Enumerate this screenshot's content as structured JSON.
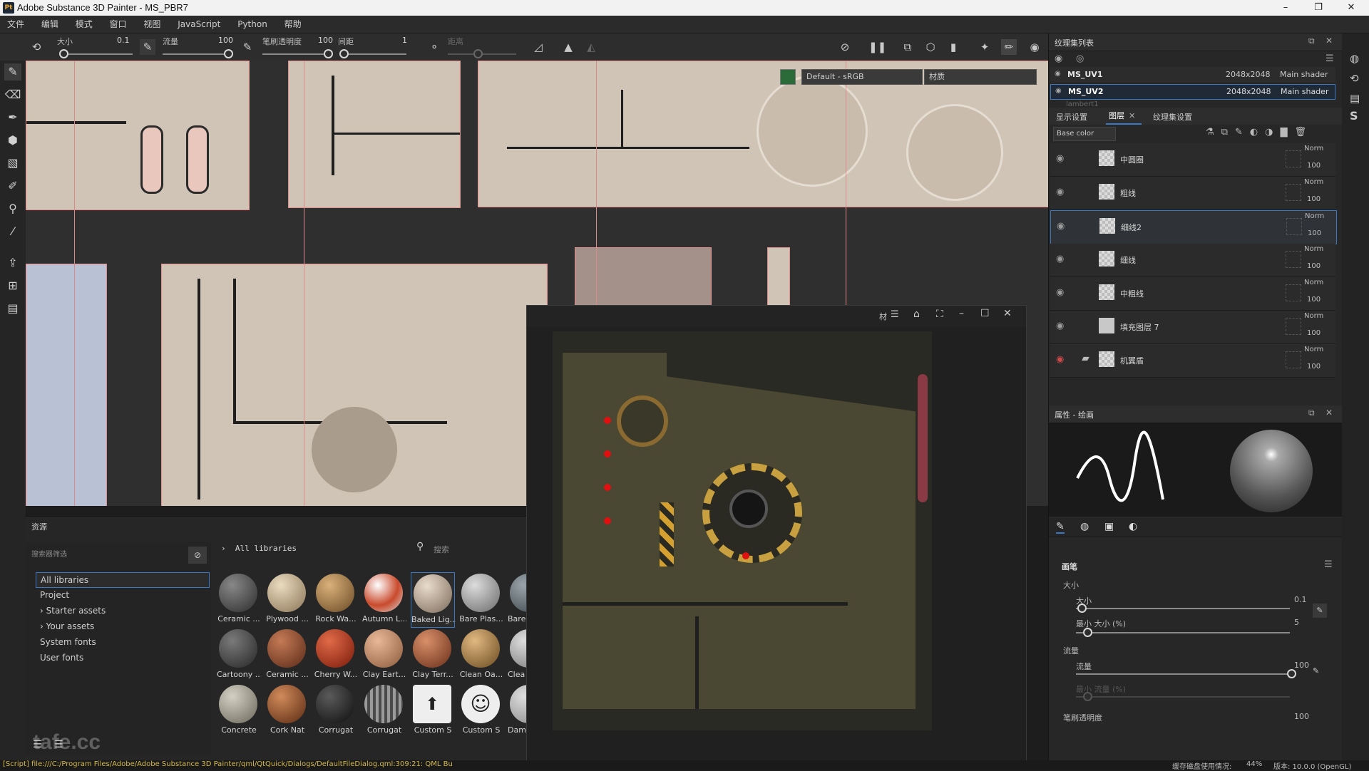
{
  "window": {
    "app_icon": "Pt",
    "title": "Adobe Substance 3D Painter - MS_PBR7",
    "minimize": "–",
    "maximize": "❐",
    "close": "✕"
  },
  "menu": [
    "文件",
    "编辑",
    "模式",
    "窗口",
    "视图",
    "JavaScript",
    "Python",
    "帮助"
  ],
  "toolbar": {
    "size_label": "大小",
    "size_value": "0.1",
    "flow_label": "流量",
    "flow_value": "100",
    "opacity_label": "笔刷透明度",
    "opacity_value": "100",
    "spacing_label": "间距",
    "spacing_value": "1",
    "angle_label": "距离"
  },
  "viewport": {
    "colorspace": "Default - sRGB",
    "material_mode": "材质"
  },
  "assets": {
    "header": "资源",
    "filter_placeholder": "搜索器筛选",
    "breadcrumb": "All libraries",
    "search_placeholder": "搜索",
    "libraries": [
      "All libraries",
      "Project",
      "Starter assets",
      "Your assets",
      "System fonts",
      "User fonts"
    ],
    "row1": [
      "Ceramic ...",
      "Plywood ...",
      "Rock Wa...",
      "Autumn L...",
      "Baked Lig...",
      "Bare Plas...",
      "Bare"
    ],
    "row2": [
      "Cartoony ...",
      "Ceramic ...",
      "Cherry W...",
      "Clay Eart...",
      "Clay Terr...",
      "Clean Oa...",
      "Clea"
    ],
    "row3": [
      "Concrete",
      "Cork Nat",
      "Corrugat",
      "Corrugat",
      "Custom S",
      "Custom S",
      "Dam"
    ],
    "watermark": "tafe.cc",
    "icon_a": "☰",
    "icon_b": "☰"
  },
  "float_window": {
    "label": "材"
  },
  "texture_set": {
    "header": "纹理集列表",
    "sets": [
      {
        "name": "MS_UV1",
        "size": "2048x2048",
        "shader": "Main shader"
      },
      {
        "name": "MS_UV2",
        "size": "2048x2048",
        "shader": "Main shader"
      }
    ],
    "partial": "lambert1"
  },
  "layers_panel": {
    "tabs": [
      "显示设置",
      "图层",
      "纹理集设置"
    ],
    "channel": "Base color",
    "layers": [
      {
        "name": "中圆圈",
        "blend": "Norm",
        "opacity": "100"
      },
      {
        "name": "粗线",
        "blend": "Norm",
        "opacity": "100"
      },
      {
        "name": "细线2",
        "blend": "Norm",
        "opacity": "100"
      },
      {
        "name": "细线",
        "blend": "Norm",
        "opacity": "100"
      },
      {
        "name": "中粗线",
        "blend": "Norm",
        "opacity": "100"
      },
      {
        "name": "填充图层 7",
        "blend": "Norm",
        "opacity": "100"
      },
      {
        "name": "机翼盾",
        "blend": "Norm",
        "opacity": "100"
      }
    ]
  },
  "properties": {
    "header": "属性 - 绘画",
    "brush_section": "画笔",
    "size_section": "大小",
    "size_label": "大小",
    "size_value": "0.1",
    "min_size_label": "最小 大小 (%)",
    "min_size_value": "5",
    "flow_section": "流量",
    "flow_label": "流量",
    "flow_value": "100",
    "min_flow_label": "最小 流量 (%)",
    "opacity_label": "笔刷透明度",
    "opacity_value": "100"
  },
  "status": {
    "script": "[Script] file:///C:/Program Files/Adobe/Adobe Substance 3D Painter/qml/QtQuick/Dialogs/DefaultFileDialog.qml:309:21: QML Bu",
    "cache": "缓存磁盘使用情况:",
    "cache_value": "44%",
    "version": "版本: 10.0.0 (OpenGL)"
  },
  "colors": {
    "accent": "#3a78c4",
    "uv_fill": "#cfc4b6",
    "uv_edge": "#e28c8c",
    "red_eye": "#c94a4a"
  }
}
